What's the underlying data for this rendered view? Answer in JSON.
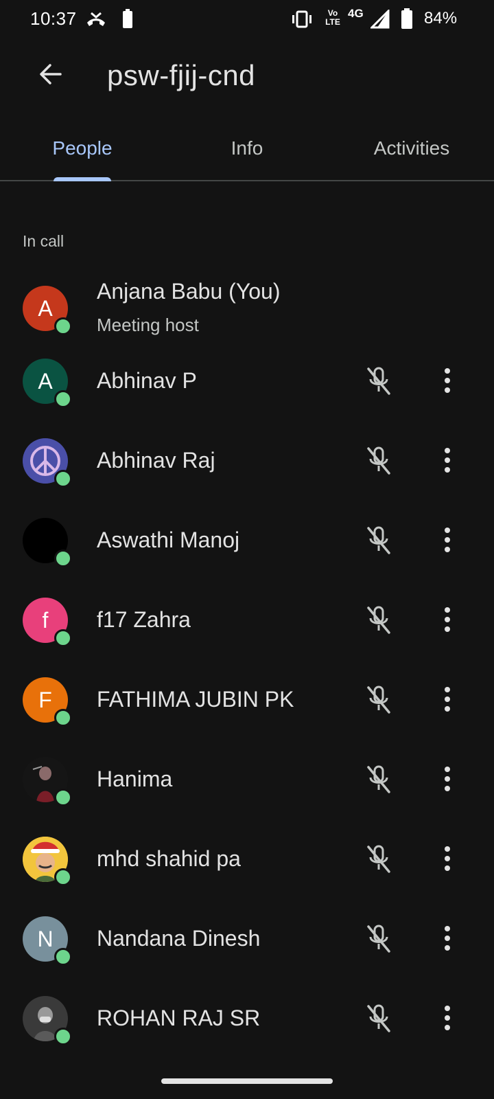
{
  "status_bar": {
    "time": "10:37",
    "battery_percent": "84%",
    "network": "4G",
    "volte": "Vo LTE",
    "icons": [
      "missed-call-icon",
      "battery-saver-icon",
      "vibrate-icon",
      "volte-icon",
      "signal-icon",
      "battery-icon"
    ]
  },
  "header": {
    "title": "psw-fjij-cnd",
    "back_icon": "arrow-back-icon"
  },
  "tabs": [
    {
      "label": "People",
      "active": true
    },
    {
      "label": "Info",
      "active": false
    },
    {
      "label": "Activities",
      "active": false
    }
  ],
  "section": {
    "label": "In call"
  },
  "participants": [
    {
      "name": "Anjana Babu (You)",
      "subtitle": "Meeting host",
      "initial": "A",
      "avatar_color": "#c5381c",
      "is_self": true
    },
    {
      "name": "Abhinav P",
      "initial": "A",
      "avatar_color": "#0a5342",
      "is_self": false
    },
    {
      "name": "Abhinav Raj",
      "initial": "",
      "avatar_color": "#3b3f8c",
      "avatar_image": "peace-sign-photo",
      "is_self": false
    },
    {
      "name": "Aswathi Manoj",
      "initial": "",
      "avatar_color": "#000000",
      "avatar_image": "black-photo",
      "is_self": false
    },
    {
      "name": "f17 Zahra",
      "initial": "f",
      "avatar_color": "#e8407b",
      "is_self": false
    },
    {
      "name": "FATHIMA JUBIN PK",
      "initial": "F",
      "avatar_color": "#e8710a",
      "is_self": false
    },
    {
      "name": "Hanima",
      "initial": "",
      "avatar_color": "#1a1a1a",
      "avatar_image": "person-photo",
      "is_self": false
    },
    {
      "name": "mhd shahid pa",
      "initial": "",
      "avatar_color": "#f2c53d",
      "avatar_image": "santa-cartoon-photo",
      "is_self": false
    },
    {
      "name": "Nandana Dinesh",
      "initial": "N",
      "avatar_color": "#78909c",
      "is_self": false
    },
    {
      "name": "ROHAN RAJ SR",
      "initial": "",
      "avatar_color": "#2b2b2b",
      "avatar_image": "grayscale-person-photo",
      "is_self": false
    }
  ],
  "row_icons": {
    "mic": "mic-off-icon",
    "more": "more-vert-icon"
  },
  "colors": {
    "background": "#131313",
    "accent": "#a8c7fa",
    "presence": "#6dd58c",
    "text_primary": "#e3e3e3",
    "text_secondary": "#c4c7c5"
  }
}
